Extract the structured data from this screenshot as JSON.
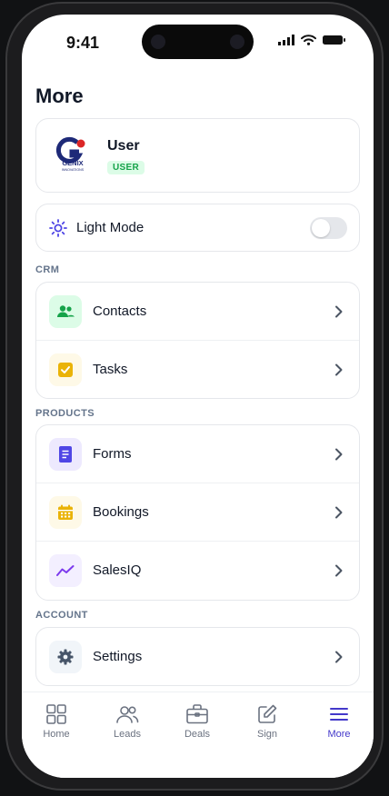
{
  "status_bar": {
    "time": "9:41"
  },
  "page": {
    "title": "More"
  },
  "profile": {
    "name": "User",
    "role": "USER",
    "logo_text": "GENIX",
    "logo_subtext": "INNOVATIONS"
  },
  "appearance": {
    "mode_label": "Light Mode",
    "mode_icon": "sun-icon",
    "dark_mode_enabled": false
  },
  "sections": {
    "crm": {
      "label": "CRM",
      "items": [
        {
          "label": "Contacts",
          "icon": "contacts-icon",
          "color": "#16a34a",
          "bg": "#dcfce7"
        },
        {
          "label": "Tasks",
          "icon": "checkbox-icon",
          "color": "#eab308",
          "bg": "#fef9e7"
        }
      ]
    },
    "products": {
      "label": "PRODUCTS",
      "items": [
        {
          "label": "Forms",
          "icon": "document-icon",
          "color": "#4f46e5",
          "bg": "#ede9fe"
        },
        {
          "label": "Bookings",
          "icon": "calendar-icon",
          "color": "#eab308",
          "bg": "#fef9e7"
        },
        {
          "label": "SalesIQ",
          "icon": "trend-icon",
          "color": "#7c3aed",
          "bg": "#f3efff"
        }
      ]
    },
    "account": {
      "label": "ACCOUNT",
      "items": [
        {
          "label": "Settings",
          "icon": "gear-icon",
          "color": "#475569",
          "bg": "#f1f5f9"
        }
      ]
    }
  },
  "tabs": [
    {
      "label": "Home",
      "icon": "grid-icon",
      "active": false
    },
    {
      "label": "Leads",
      "icon": "users-icon",
      "active": false
    },
    {
      "label": "Deals",
      "icon": "briefcase-icon",
      "active": false
    },
    {
      "label": "Sign",
      "icon": "edit-icon",
      "active": false
    },
    {
      "label": "More",
      "icon": "menu-icon",
      "active": true
    }
  ],
  "colors": {
    "accent": "#4338ca",
    "text": "#111827",
    "muted": "#64748b"
  }
}
